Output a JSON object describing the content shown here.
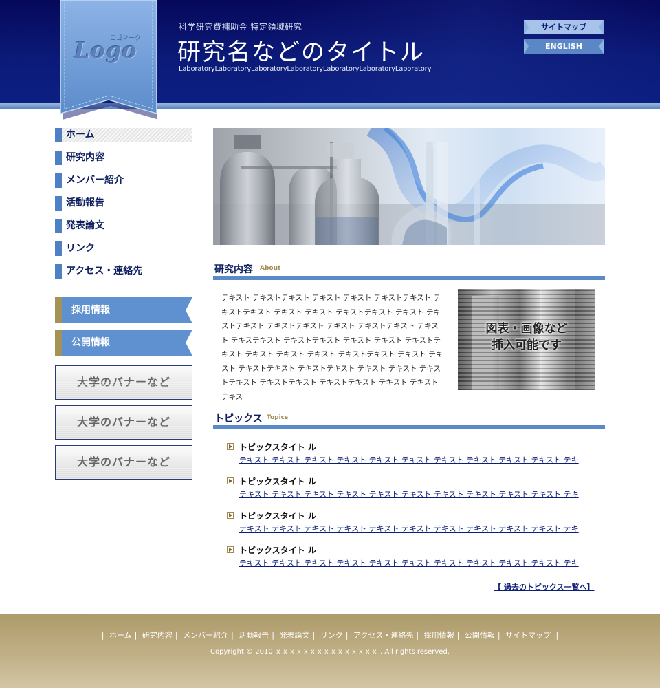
{
  "header": {
    "subtitle": "科学研究費補助金 特定領域研究",
    "title": "研究名などのタイトル",
    "lab": "LaboratoryLaboratoryLaboratoryLaboratoryLaboratoryLaboratoryLaboratory",
    "logo_small": "ロゴマーク",
    "logo_text": "Logo",
    "sitemap_label": "サイトマップ",
    "english_label": "ENGLISH"
  },
  "nav": {
    "items": [
      {
        "label": "ホーム"
      },
      {
        "label": "研究内容"
      },
      {
        "label": "メンバー紹介"
      },
      {
        "label": "活動報告"
      },
      {
        "label": "発表論文"
      },
      {
        "label": "リンク"
      },
      {
        "label": "アクセス・連絡先"
      }
    ],
    "recruit_label": "採用情報",
    "public_label": "公開情報",
    "banners": [
      "大学のバナーなど",
      "大学のバナーなど",
      "大学のバナーなど"
    ]
  },
  "about": {
    "heading": "研究内容",
    "heading_en": "About",
    "body": "テキスト テキストテキスト テキスト テキスト テキストテキスト テキストテキスト テキスト テキスト テキストテキスト テキスト テキストテキスト テキストテキスト テキスト テキストテキスト テキスト テキステキスト テキストテキスト テキスト テキスト テキストテキスト テキスト テキスト テキスト テキストテキスト テキスト テキスト テキストテキスト テキストテキスト テキスト テキスト テキストテキスト テキストテキスト テキストテキスト テキスト テキスト テキス",
    "figure_caption_1": "図表・画像など",
    "figure_caption_2": "挿入可能です"
  },
  "topics": {
    "heading": "トピックス",
    "heading_en": "Topics",
    "items": [
      {
        "title": "トピックスタイト ル",
        "text": "テキスト テキスト テキスト テキスト テキスト テキスト テキスト テキスト テキスト テキスト テキ"
      },
      {
        "title": "トピックスタイト ル",
        "text": "テキスト テキスト テキスト テキスト テキスト テキスト テキスト テキスト テキスト テキスト テキ"
      },
      {
        "title": "トピックスタイト ル",
        "text": "テキスト テキスト テキスト テキスト テキスト テキスト テキスト テキスト テキスト テキスト テキ"
      },
      {
        "title": "トピックスタイト ル",
        "text": "テキスト テキスト テキスト テキスト テキスト テキスト テキスト テキスト テキスト テキスト テキ"
      }
    ],
    "more_label": "【 過去のトピックス一覧へ】"
  },
  "footer": {
    "links": [
      "ホーム",
      "研究内容",
      "メンバー紹介",
      "活動報告",
      "発表論文",
      "リンク",
      "アクセス・連絡先",
      "採用情報",
      "公開情報",
      "サイトマップ"
    ],
    "copyright": "Copyright © 2010 ｘｘｘｘｘｘｘｘｘｘｘｘｘｘｘ . All rights reserved."
  },
  "colors": {
    "header_navy": "#06085a",
    "accent_blue": "#5a8bc8",
    "gold": "#a59256",
    "link": "#0c1f78"
  }
}
